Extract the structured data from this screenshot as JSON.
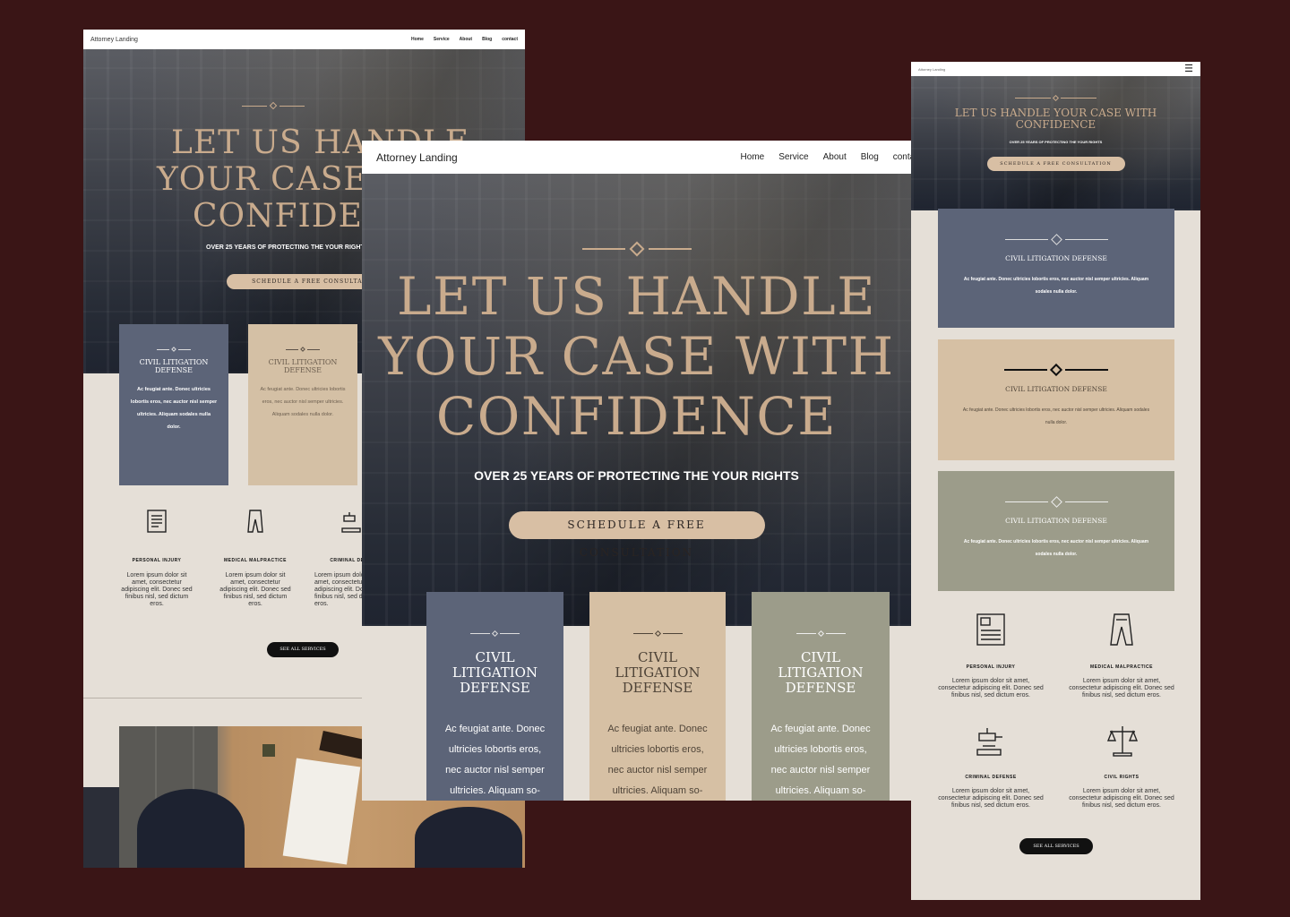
{
  "brand": "Attorney Landing",
  "nav": [
    "Home",
    "Service",
    "About",
    "Blog",
    "contact"
  ],
  "nav_small": [
    "Home",
    "Service",
    "About",
    "Blog",
    "contact"
  ],
  "hero": {
    "headline_line1": "LET US HANDLE",
    "headline_line2": "YOUR CASE WITH",
    "headline_line3": "CONFIDENCE",
    "headline_single": "LET US HANDLE YOUR CASE WITH CONFIDENCE",
    "subheading": "OVER 25 YEARS OF PROTECTING THE YOUR RIGHTS",
    "cta": "SCHEDULE A FREE CONSULTATION"
  },
  "cards": [
    {
      "title": "CIVIL LITIGATION DEFENSE",
      "text": "Ac feugiat ante. Donec ultricies lobortis eros, nec auctor nisl semper ultricies. Aliquam sodales nulla dolor."
    },
    {
      "title": "CIVIL LITIGATION DEFENSE",
      "text": "Ac feugiat ante. Donec ultricies lobortis eros, nec auctor nisl semper ultricies. Aliquam sodales nulla dolor."
    },
    {
      "title": "CIVIL LITIGATION DEFENSE",
      "text": "Ac feugiat ante. Donec ultricies lobortis eros, nec auctor nisl semper ultricies. Aliquam sodales nulla dolor."
    }
  ],
  "card_text_lines": [
    "Ac feugiat ante. Donec",
    "ultricies lobortis eros,",
    "nec auctor nisl semper",
    "ultricies. Aliquam so-"
  ],
  "card_title_lines": [
    "CIVIL",
    "LITIGATION",
    "DEFENSE"
  ],
  "services": [
    {
      "title": "PERSONAL INJURY",
      "text": "Lorem ipsum dolor sit amet, consectetur adipiscing elit. Donec sed finibus nisl, sed dictum eros.",
      "icon": "document-icon"
    },
    {
      "title": "MEDICAL MALPRACTICE",
      "text": "Lorem ipsum dolor sit amet, consectetur adipiscing elit. Donec sed finibus nisl, sed dictum eros.",
      "icon": "lab-coat-icon"
    },
    {
      "title": "CRIMINAL DEFENSE",
      "text": "Lorem ipsum dolor sit amet, consectetur adipiscing elit. Donec sed finibus nisl, sed dictum eros.",
      "icon": "gavel-icon"
    },
    {
      "title": "CIVIL RIGHTS",
      "text": "Lorem ipsum dolor sit amet, consectetur adipiscing elit. Donec sed finibus nisl, sed dictum eros.",
      "icon": "scales-icon"
    }
  ],
  "see_all": "SEE ALL SERVICES",
  "colors": {
    "background": "#3a1516",
    "gold": "#c9ab8d",
    "blue_card": "#5c6478",
    "tan_card": "#d6c0a4",
    "sage_card": "#9c9c8a"
  }
}
